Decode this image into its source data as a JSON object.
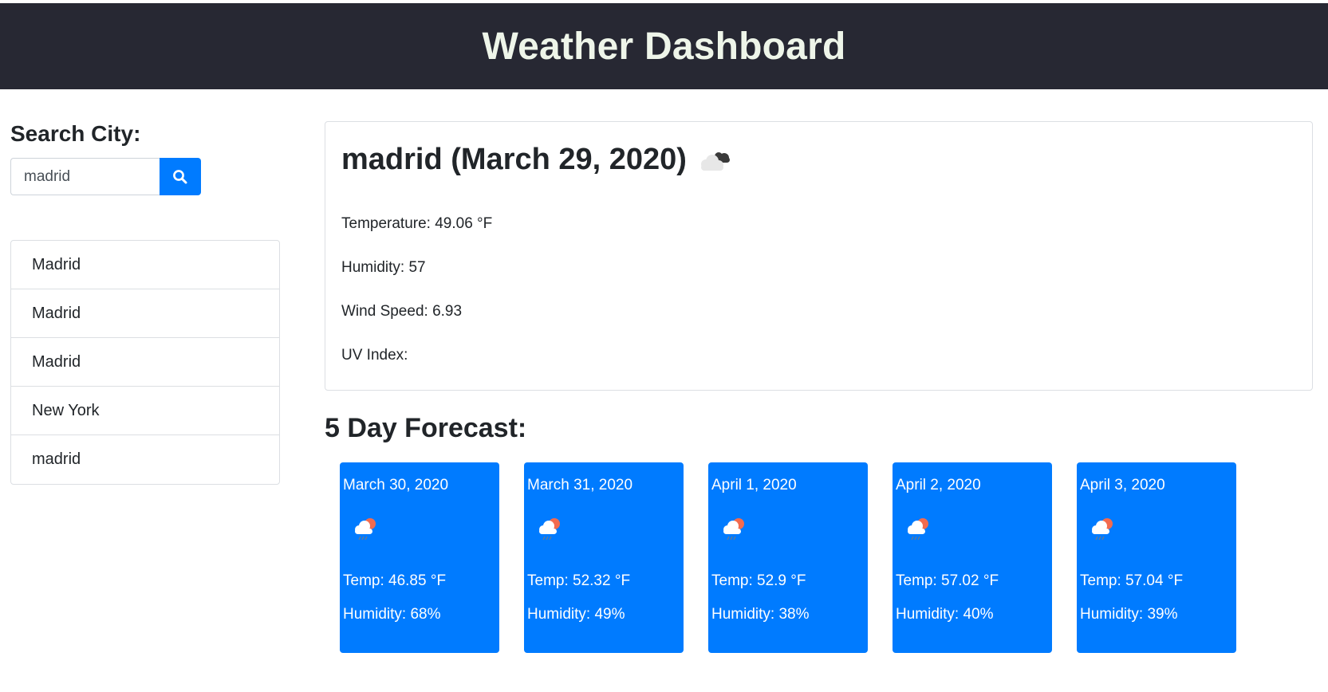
{
  "header": {
    "title": "Weather Dashboard"
  },
  "search": {
    "label": "Search City:",
    "value": "madrid",
    "button_icon": "search-icon"
  },
  "history": [
    {
      "label": "Madrid"
    },
    {
      "label": "Madrid"
    },
    {
      "label": "Madrid"
    },
    {
      "label": "New York"
    },
    {
      "label": "madrid"
    }
  ],
  "current": {
    "title": "madrid (March 29, 2020)",
    "icon": "broken-clouds-icon",
    "temperature": "Temperature: 49.06 °F",
    "humidity": "Humidity: 57",
    "wind": "Wind Speed: 6.93",
    "uv": "UV Index:"
  },
  "forecast": {
    "title": "5 Day Forecast:",
    "days": [
      {
        "date": "March 30, 2020",
        "icon": "rain-sun-icon",
        "temp": "Temp: 46.85 °F",
        "humidity": "Humidity: 68%"
      },
      {
        "date": "March 31, 2020",
        "icon": "rain-sun-icon",
        "temp": "Temp: 52.32 °F",
        "humidity": "Humidity: 49%"
      },
      {
        "date": "April 1, 2020",
        "icon": "rain-sun-icon",
        "temp": "Temp: 52.9 °F",
        "humidity": "Humidity: 38%"
      },
      {
        "date": "April 2, 2020",
        "icon": "rain-sun-icon",
        "temp": "Temp: 57.02 °F",
        "humidity": "Humidity: 40%"
      },
      {
        "date": "April 3, 2020",
        "icon": "rain-sun-icon",
        "temp": "Temp: 57.04 °F",
        "humidity": "Humidity: 39%"
      }
    ]
  },
  "colors": {
    "header_bg": "#272833",
    "header_text": "#eef5e9",
    "accent": "#007bff"
  }
}
